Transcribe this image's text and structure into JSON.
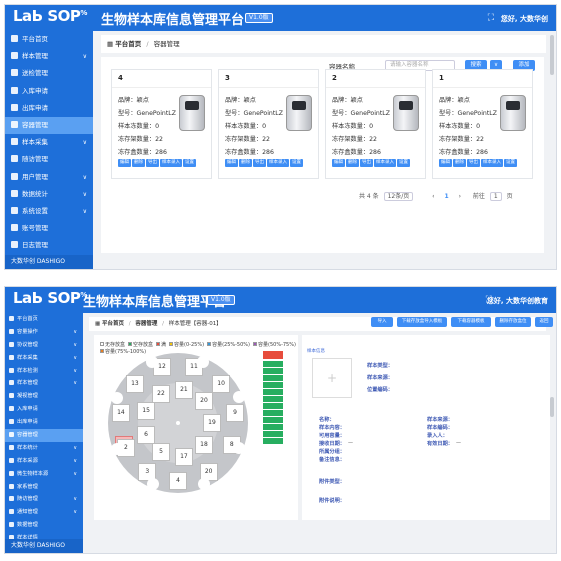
{
  "colors": {
    "primary": "#1e6fd9",
    "sidebar_active": "#5aa0f2",
    "button": "#3f8ef5",
    "red_slot": "#f7b9b9"
  },
  "screen1": {
    "logo": "LaЬ SOP",
    "title": "生物样本库信息管理平台",
    "badge": "V1.0版",
    "user": "您好, 大数华创",
    "sidebar": [
      {
        "label": "平台首页",
        "icon": "home-icon"
      },
      {
        "label": "样本管理",
        "icon": "database-icon",
        "arrow": "∨"
      },
      {
        "label": "送检管理",
        "icon": "send-icon"
      },
      {
        "label": "入库申请",
        "icon": "inbox-icon"
      },
      {
        "label": "出库申请",
        "icon": "outbox-icon"
      },
      {
        "label": "容器管理",
        "icon": "container-icon",
        "active": true
      },
      {
        "label": "样本采集",
        "icon": "gear-icon",
        "arrow": "∨"
      },
      {
        "label": "随访管理",
        "icon": "calendar-icon"
      },
      {
        "label": "用户管理",
        "icon": "user-icon",
        "arrow": "∨"
      },
      {
        "label": "数据统计",
        "icon": "chart-icon",
        "arrow": "∨"
      },
      {
        "label": "系统设置",
        "icon": "settings-icon",
        "arrow": "∨"
      },
      {
        "label": "账号管理",
        "icon": "account-icon"
      },
      {
        "label": "日志管理",
        "icon": "log-icon"
      }
    ],
    "sidebar_footer": "大数华创 DASHIGO",
    "breadcrumb": {
      "home": "平台首页",
      "current": "容器管理"
    },
    "search": {
      "label": "容器名称",
      "placeholder": "请输入容器名称",
      "search_btn": "搜索",
      "dropdown": "∨",
      "add_btn": "添加"
    },
    "cards": [
      {
        "num": "4",
        "brand": "品牌：颖点",
        "model": "型号：GenePointLZ",
        "frozen": "样本冻数量：0",
        "racks": "冻存架数量：22",
        "boxes": "冻存盒数量：286"
      },
      {
        "num": "3",
        "brand": "品牌：颖点",
        "model": "型号：GenePointLZ",
        "frozen": "样本冻数量：0",
        "racks": "冻存架数量：22",
        "boxes": "冻存盒数量：286"
      },
      {
        "num": "2",
        "brand": "品牌：颖点",
        "model": "型号：GenePointLZ",
        "frozen": "样本冻数量：0",
        "racks": "冻存架数量：22",
        "boxes": "冻存盒数量：286"
      },
      {
        "num": "1",
        "brand": "品牌：颖点",
        "model": "型号：GenePointLZ",
        "frozen": "样本冻数量：0",
        "racks": "冻存架数量：22",
        "boxes": "冻存盒数量：286"
      }
    ],
    "card_actions": [
      "编辑",
      "删除",
      "导出",
      "样本录入",
      "设置"
    ],
    "pager": {
      "total": "共 4 条",
      "size": "12条/页",
      "prev": "‹",
      "page": "1",
      "next": "›",
      "goto": "前往",
      "goto_val": "1",
      "unit": "页"
    }
  },
  "screen2": {
    "logo": "LaЬ SOP",
    "title": "生物样本库信息管理平台",
    "badge": "V1.0版",
    "user": "您好, 大数华创教育",
    "sidebar": [
      {
        "label": "平台首页"
      },
      {
        "label": "容量操作",
        "arrow": "∨"
      },
      {
        "label": "协议管理",
        "arrow": "∨"
      },
      {
        "label": "样本采集",
        "arrow": "∨"
      },
      {
        "label": "样本检测",
        "arrow": "∨"
      },
      {
        "label": "样本管理",
        "arrow": "∨"
      },
      {
        "label": "凝视管理"
      },
      {
        "label": "入库申请"
      },
      {
        "label": "出库申请"
      },
      {
        "label": "容器管理",
        "active": true
      },
      {
        "label": "样本统计",
        "arrow": "∨"
      },
      {
        "label": "样本采源",
        "arrow": "∨"
      },
      {
        "label": "微生物样本源",
        "arrow": "∨"
      },
      {
        "label": "家系管理"
      },
      {
        "label": "随访管理",
        "arrow": "∨"
      },
      {
        "label": "通知管理",
        "arrow": "∨"
      },
      {
        "label": "数据管理"
      },
      {
        "label": "样本详情"
      }
    ],
    "sidebar_footer": "大数华创 DASHIGO",
    "breadcrumb": {
      "home": "平台首页",
      "mid": "容器管理",
      "current": "样本管理【容器-01】"
    },
    "toolbar": [
      "导入",
      "下载存放盒导入模板",
      "下载容器模板",
      "删除存放盒位",
      "返回"
    ],
    "legend": [
      {
        "label": "无存放盒",
        "color": "#ffffff"
      },
      {
        "label": "空存放盒",
        "color": "#27ae60"
      },
      {
        "label": "满",
        "color": "#e74c3c"
      },
      {
        "label": "容量(0-25%)",
        "color": "#f1c40f"
      },
      {
        "label": "容量(25%-50%)",
        "color": "#3498db"
      },
      {
        "label": "容量(50%-75%)",
        "color": "#9b59b6"
      },
      {
        "label": "容量(75%-100%)",
        "color": "#e67e22"
      }
    ],
    "slots": [
      "1",
      "14",
      "13",
      "12",
      "11",
      "10",
      "9",
      "8",
      "20",
      "19",
      "18",
      "17",
      "16",
      "15",
      "22",
      "21",
      "3",
      "4",
      "5",
      "6",
      "7",
      "2"
    ],
    "info_title": "样本信息",
    "photo_placeholder": "+",
    "fields_top": [
      "样本类型：",
      "样本来源：",
      "位置编码："
    ],
    "fields_left": [
      "名称：",
      "样本内容：",
      "可用容量：",
      "接收日期：",
      "所属分组：",
      "备注信息："
    ],
    "fields_right": [
      "样本来源：",
      "样本编码：",
      "录入人：",
      "有效日期："
    ],
    "val_recv": "—",
    "val_valid": "—",
    "attach1": "附件类型：",
    "attach2": "附件说明："
  }
}
